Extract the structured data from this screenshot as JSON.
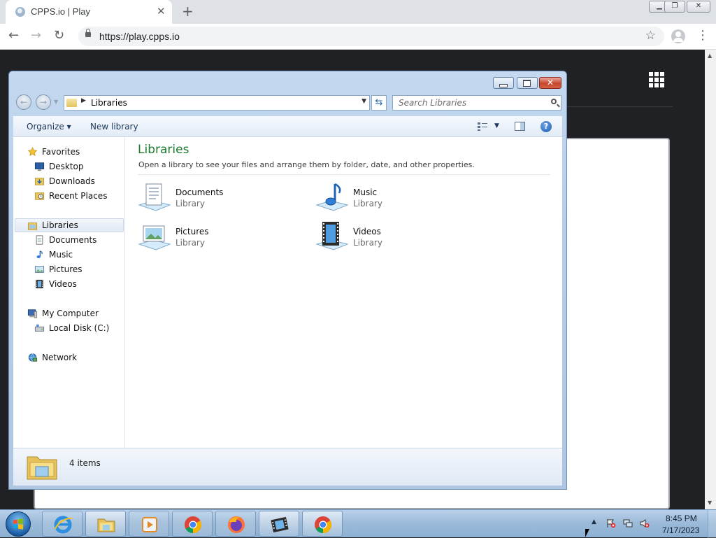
{
  "browser": {
    "tab_title": "CPPS.io | Play",
    "tab_close": "✕",
    "new_tab": "+",
    "url": "https://play.cpps.io",
    "window_controls": {
      "minimize": "▁",
      "restore": "❐",
      "close": "✕"
    }
  },
  "explorer": {
    "address": "Libraries",
    "search_placeholder": "Search Libraries",
    "toolbar": {
      "organize": "Organize ▾",
      "new_library": "New library"
    },
    "nav": {
      "favorites_header": "Favorites",
      "favorites": [
        "Desktop",
        "Downloads",
        "Recent Places"
      ],
      "libraries_header": "Libraries",
      "libraries": [
        "Documents",
        "Music",
        "Pictures",
        "Videos"
      ],
      "computer_header": "My Computer",
      "computer": [
        "Local Disk (C:)"
      ],
      "network_header": "Network"
    },
    "content": {
      "title": "Libraries",
      "description": "Open a library to see your files and arrange them by folder, date, and other properties.",
      "items": [
        {
          "name": "Documents",
          "type": "Library",
          "icon": "documents-library-icon"
        },
        {
          "name": "Music",
          "type": "Library",
          "icon": "music-library-icon"
        },
        {
          "name": "Pictures",
          "type": "Library",
          "icon": "pictures-library-icon"
        },
        {
          "name": "Videos",
          "type": "Library",
          "icon": "videos-library-icon"
        }
      ]
    },
    "details": {
      "count": "4 items"
    }
  },
  "taskbar": {
    "apps": [
      "internet-explorer-icon",
      "file-explorer-icon",
      "media-player-icon",
      "chrome-icon",
      "firefox-icon",
      "movie-maker-icon",
      "chrome-icon"
    ],
    "clock_time": "8:45 PM",
    "clock_date": "7/17/2023"
  },
  "colors": {
    "accent_green": "#1e7a2f",
    "explorer_frame": "#b5cde8",
    "taskbar": "#9dbbd9",
    "browser_bg": "#202124"
  }
}
